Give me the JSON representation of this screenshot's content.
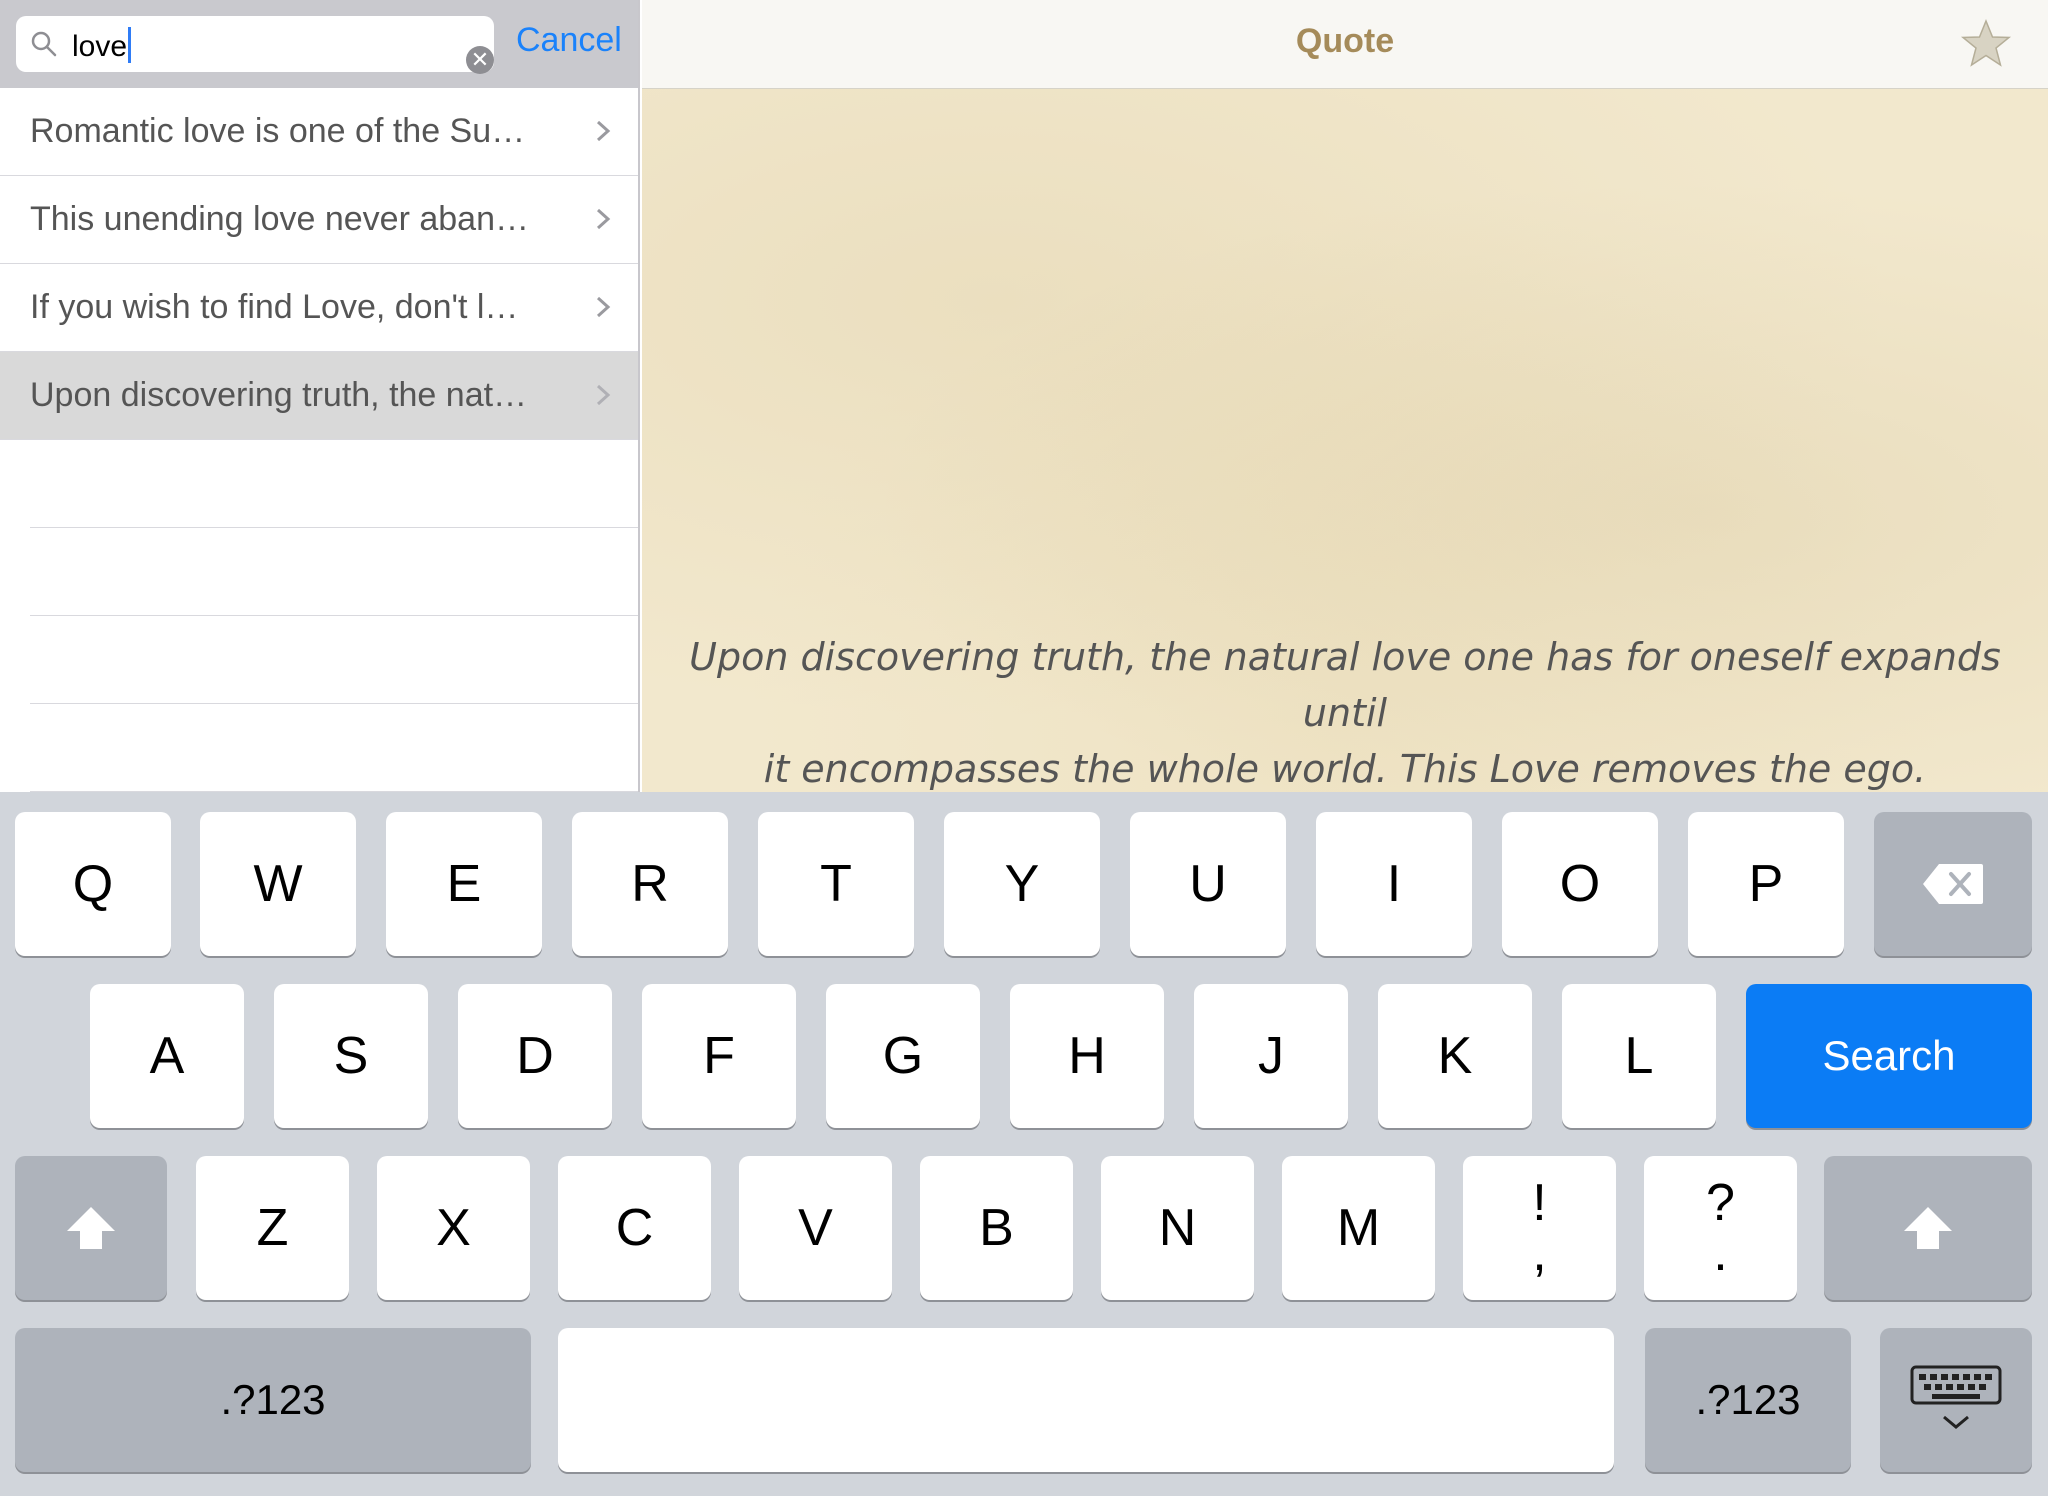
{
  "search": {
    "query": "love",
    "cancel_label": "Cancel"
  },
  "results": [
    "Romantic love is one of the Su…",
    "This unending love never aban…",
    "If you wish to find Love, don't l…",
    "Upon discovering truth, the nat…"
  ],
  "selected_index": 3,
  "detail": {
    "title": "Quote",
    "quote_line1": "Upon discovering truth, the natural love one has for oneself expands until",
    "quote_line2": "it encompasses the whole world. This Love removes the ego.",
    "favorite_icon": "star-icon"
  },
  "keyboard": {
    "row1": [
      "Q",
      "W",
      "E",
      "R",
      "T",
      "Y",
      "U",
      "I",
      "O",
      "P"
    ],
    "row2": [
      "A",
      "S",
      "D",
      "F",
      "G",
      "H",
      "J",
      "K",
      "L"
    ],
    "row3": [
      "Z",
      "X",
      "C",
      "V",
      "B",
      "N",
      "M"
    ],
    "punct1_top": "!",
    "punct1_bottom": ",",
    "punct2_top": "?",
    "punct2_bottom": ".",
    "search_label": "Search",
    "numbers_label_left": ".?123",
    "numbers_label_right": ".?123",
    "space_label": "",
    "icons": {
      "backspace": "backspace-icon",
      "shift": "shift-icon",
      "dismiss": "keyboard-dismiss-icon"
    }
  },
  "colors": {
    "accent": "#1a82fb",
    "title": "#a58b5a",
    "search_key": "#0b7cf5",
    "paper": "#f2e8cd",
    "keyboard_bg": "#d1d5db"
  }
}
